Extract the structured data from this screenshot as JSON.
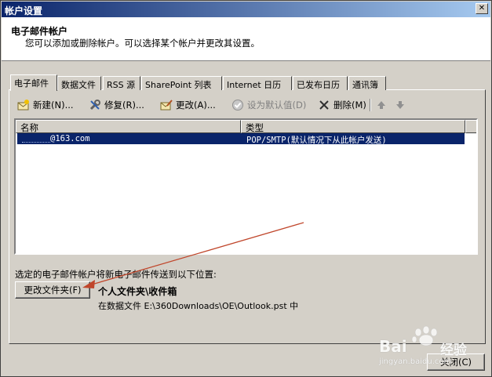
{
  "window": {
    "title": "帐户设置"
  },
  "header": {
    "title": "电子邮件帐户",
    "subtitle": "您可以添加或删除帐户。可以选择某个帐户并更改其设置。"
  },
  "tabs": [
    {
      "label": "电子邮件",
      "active": true
    },
    {
      "label": "数据文件"
    },
    {
      "label": "RSS 源"
    },
    {
      "label": "SharePoint 列表"
    },
    {
      "label": "Internet 日历"
    },
    {
      "label": "已发布日历"
    },
    {
      "label": "通讯簿"
    }
  ],
  "toolbar": {
    "new_label": "新建(N)...",
    "repair_label": "修复(R)...",
    "change_label": "更改(A)...",
    "default_label": "设为默认值(D)",
    "remove_label": "删除(M)"
  },
  "list": {
    "columns": [
      "名称",
      "类型"
    ],
    "rows": [
      {
        "name": "@163.com",
        "type": "POP/SMTP(默认情况下从此帐户发送)"
      }
    ]
  },
  "delivery": {
    "label": "选定的电子邮件帐户将新电子邮件传送到以下位置:",
    "change_folder_label": "更改文件夹(F)",
    "folder_name": "个人文件夹\\收件箱",
    "folder_path": "在数据文件 E:\\360Downloads\\OE\\Outlook.pst 中"
  },
  "footer": {
    "close_label": "关闭(C)"
  },
  "watermark": {
    "brand": "Bai",
    "brand2": "经验",
    "url": "jingyan.baidu.com"
  },
  "colors": {
    "accent": "#0a246a",
    "arrow": "#c0462b"
  }
}
